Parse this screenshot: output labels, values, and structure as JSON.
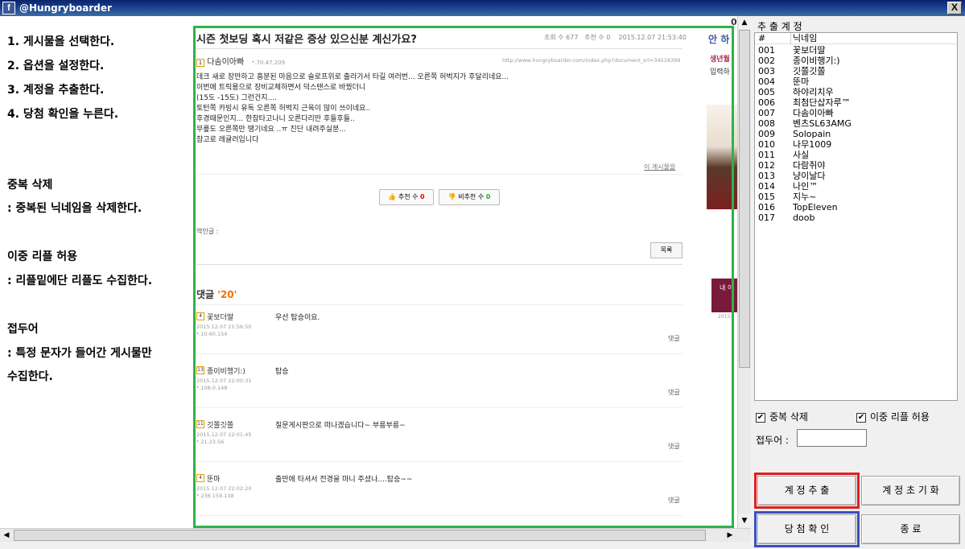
{
  "window": {
    "title": "@Hungryboarder",
    "title_icon": "f",
    "close": "X"
  },
  "instructions": {
    "steps": [
      "1. 게시물을 선택한다.",
      "2. 옵션을 설정한다.",
      "3. 계정을 추출한다.",
      "4. 당첨 확인을 누른다."
    ],
    "dedupe_title": "중복 삭제",
    "dedupe_desc": ": 중복된 닉네임을 삭제한다.",
    "double_title": "이중 리플 허용",
    "double_desc": ": 리플밑에단 리플도 수집한다.",
    "prefix_title": "접두어",
    "prefix_desc1": ": 특정 문자가 들어간 게시물만",
    "prefix_desc2": "수집한다."
  },
  "post": {
    "title": "시즌 첫보딩 혹시 저같은 증상 있으신분 계신가요?",
    "views_label": "조회 수",
    "views": "677",
    "recs_label": "추천 수",
    "recs": "0",
    "datetime": "2015.12.07 21:53:40",
    "author_level": "1",
    "author": "다솜이아빠",
    "author_ip": "*.70.47.209",
    "url": "http://www.hungryboarder.com/index.php?document_srl=34518399",
    "body": [
      "데크 새로 장만하고 흥분된 마음으로 슬로프위로 출라가서 타길 여러번... 오른쪽 허벅지가 후달리네요...",
      "이번에 트릭용으로 장비교체하면서 덕스탠스로 바꿨더니",
      "(15도 -15도) 그런건지....",
      "토턴쪽 카빙시 유독 오른쪽 허벅지 근육이 많이 쓰이네요..",
      "후경때문인지... 한참타고나니 오른다리만 후들후들..",
      "무릎도 오른쪽만 땡기네요 ..ㅠ 진단 내려주실분...",
      "참고로 레귤러입니다"
    ],
    "this_post_link": "이 게시물을",
    "rec_btn_label": "추천 수",
    "rec_btn_count": "0",
    "nrec_btn_label": "비추천 수",
    "nrec_btn_count": "0",
    "trackback": "역인글 :",
    "list_btn": "목록",
    "comments_label": "댓글",
    "comments_count": "'20'"
  },
  "comments": [
    {
      "level": "4",
      "name": "꽃보더딸",
      "date": "2015.12.07 21:56:50",
      "ip": "*.10.60.154",
      "text": "우선 탑승이요.",
      "reply": "댓글"
    },
    {
      "level": "13",
      "name": "종이비행기:)",
      "date": "2015.12.07 22:00:31",
      "ip": "*.108.0.148",
      "text": "탑승",
      "reply": "댓글"
    },
    {
      "level": "11",
      "name": "깃쫄깃쫄",
      "date": "2015.12.07 22:01:45",
      "ip": "*.21.23.56",
      "text": "질문게시판으로 떠나겠습니다~ 부릉부릉~",
      "reply": "댓글"
    },
    {
      "level": "4",
      "name": "뚠마",
      "date": "2015.12.07 22:02:20",
      "ip": "*.236.159.138",
      "text": "출만에 타셔서 전경을 마니 주셨나....탑승~~",
      "reply": "댓글"
    }
  ],
  "ad": {
    "l1": "안 하",
    "l2": "생년월",
    "l3": "입력하",
    "box": "내 이",
    "date": "2015-"
  },
  "page_num": "0",
  "accounts": {
    "group_title": "추 출 계 정",
    "col_num": "#",
    "col_nick": "닉네임",
    "rows": [
      [
        "001",
        "꽃보더딸"
      ],
      [
        "002",
        "종이비행기:)"
      ],
      [
        "003",
        "깃쫄깃쫄"
      ],
      [
        "004",
        "뚠마"
      ],
      [
        "005",
        "하야리치우"
      ],
      [
        "006",
        "최첨단삽자루™"
      ],
      [
        "007",
        "다솜이아빠"
      ],
      [
        "008",
        "벤츠SL63AMG"
      ],
      [
        "009",
        "Solopain"
      ],
      [
        "010",
        "나무1009"
      ],
      [
        "011",
        "사실"
      ],
      [
        "012",
        "다람쥐야"
      ],
      [
        "013",
        "냥이날다"
      ],
      [
        "014",
        "나인™"
      ],
      [
        "015",
        "지누~"
      ],
      [
        "016",
        "TopEleven"
      ],
      [
        "017",
        "doob"
      ]
    ]
  },
  "options": {
    "dedupe": "중복 삭제",
    "double": "이중 리플 허용",
    "prefix_label": "접두어 :",
    "prefix_value": ""
  },
  "buttons": {
    "extract": "계 정 추 출",
    "reset": "계 정 초 기 화",
    "check": "당 첨 확 인",
    "exit": "종 료"
  },
  "colors": {
    "green": "#2db34a",
    "red": "#e02020",
    "blue": "#3a4fc0"
  }
}
